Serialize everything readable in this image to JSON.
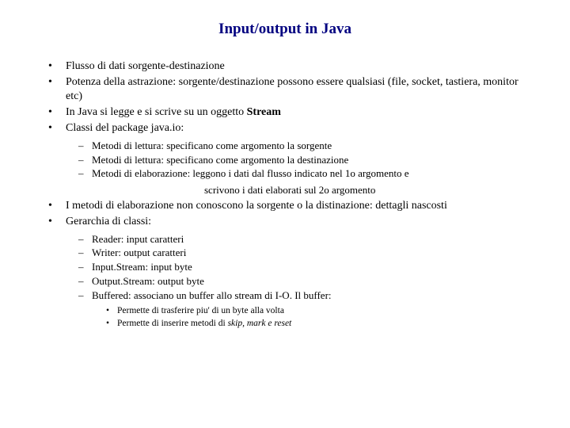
{
  "title": "Input/output in Java",
  "b1": "Flusso di dati sorgente-destinazione",
  "b2": "Potenza della astrazione: sorgente/destinazione possono essere qualsiasi (file, socket, tastiera, monitor etc)",
  "b3a": "In Java si legge e si scrive su un oggetto ",
  "b3b": "Stream",
  "b4": "Classi del package java.io:",
  "s1a": "Metodi di lettura: specificano come argomento la sorgente",
  "s1b": "Metodi di lettura: specificano come argomento la destinazione",
  "s1c": "Metodi di elaborazione:    leggono  i dati dal flusso indicato nel 1o argomento e",
  "s1c_cont": "scrivono i dati elaborati sul 2o argomento",
  "b5": "I metodi di elaborazione non conoscono la sorgente o la distinazione: dettagli nascosti",
  "b6": "Gerarchia di classi:",
  "s2a": "Reader: input caratteri",
  "s2b": "Writer: output caratteri",
  "s2c": "Input.Stream: input byte",
  "s2d": "Output.Stream: output byte",
  "s2e": "Buffered: associano un buffer allo stream di I-O. Il buffer:",
  "s3a_pre": "Permette di trasferire piu",
  "s3a_post": " di un byte alla volta",
  "s3b_pre": "Permette di inserire metodi di ",
  "s3b_ital": "skip, mark e reset"
}
